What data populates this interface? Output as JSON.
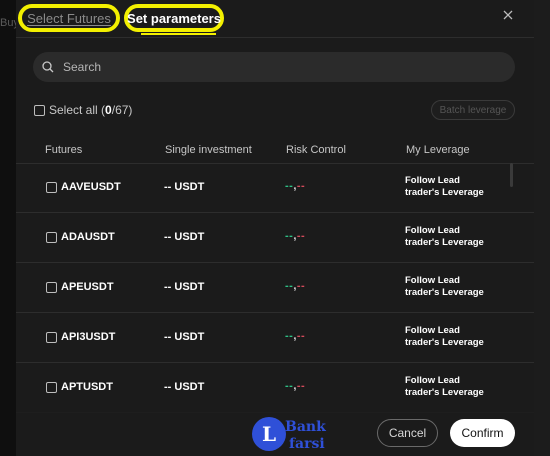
{
  "background": {
    "partial_text": "Buy"
  },
  "tabs": [
    {
      "label": "Select Futures",
      "active": false
    },
    {
      "label": "Set parameters",
      "active": true
    }
  ],
  "highlight_color": "#f3f000",
  "search": {
    "placeholder": "Search",
    "value": ""
  },
  "select_all": {
    "label": "Select all",
    "selected": "0",
    "total": "/67"
  },
  "batch_button": {
    "label": "Batch leverage"
  },
  "columns": [
    "Futures",
    "Single investment",
    "Risk Control",
    "My Leverage"
  ],
  "rows": [
    {
      "symbol": "AAVEUSDT",
      "investment": "-- USDT",
      "risk_green": "--",
      "risk_sep": ",",
      "risk_red": "--",
      "leverage_line1": "Follow Lead",
      "leverage_line2": "trader's Leverage"
    },
    {
      "symbol": "ADAUSDT",
      "investment": "-- USDT",
      "risk_green": "--",
      "risk_sep": ",",
      "risk_red": "--",
      "leverage_line1": "Follow Lead",
      "leverage_line2": "trader's Leverage"
    },
    {
      "symbol": "APEUSDT",
      "investment": "-- USDT",
      "risk_green": "--",
      "risk_sep": ",",
      "risk_red": "--",
      "leverage_line1": "Follow Lead",
      "leverage_line2": "trader's Leverage"
    },
    {
      "symbol": "API3USDT",
      "investment": "-- USDT",
      "risk_green": "--",
      "risk_sep": ",",
      "risk_red": "--",
      "leverage_line1": "Follow Lead",
      "leverage_line2": "trader's Leverage"
    },
    {
      "symbol": "APTUSDT",
      "investment": "-- USDT",
      "risk_green": "--",
      "risk_sep": ",",
      "risk_red": "--",
      "leverage_line1": "Follow Lead",
      "leverage_line2": "trader's Leverage"
    }
  ],
  "watermark": {
    "letter": "L",
    "line1": "Bank",
    "line2": "farsi"
  },
  "buttons": {
    "cancel": "Cancel",
    "confirm": "Confirm"
  },
  "colors": {
    "risk_green": "#2fbf85",
    "risk_red": "#d24b5a",
    "confirm_bg": "#ffffff"
  }
}
